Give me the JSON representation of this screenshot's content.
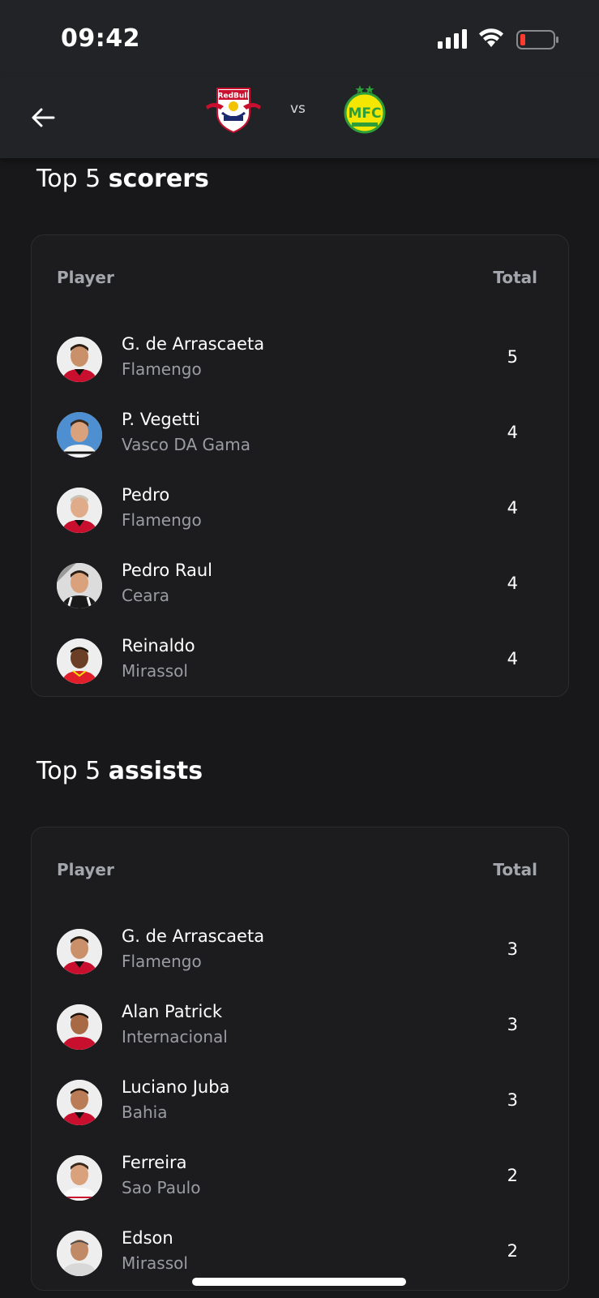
{
  "status_bar": {
    "time": "09:42"
  },
  "header": {
    "vs_label": "vs",
    "home_team_logo": "RedBull Bragantino",
    "away_team_logo": "MFC Mirassol"
  },
  "scorers": {
    "title_prefix": "Top 5 ",
    "title_bold": "scorers",
    "col_player": "Player",
    "col_total": "Total",
    "rows": [
      {
        "name": "G. de Arrascaeta",
        "team": "Flamengo",
        "value": "5"
      },
      {
        "name": "P. Vegetti",
        "team": "Vasco DA Gama",
        "value": "4"
      },
      {
        "name": "Pedro",
        "team": "Flamengo",
        "value": "4"
      },
      {
        "name": "Pedro Raul",
        "team": "Ceara",
        "value": "4"
      },
      {
        "name": "Reinaldo",
        "team": "Mirassol",
        "value": "4"
      }
    ]
  },
  "assists": {
    "title_prefix": "Top 5 ",
    "title_bold": "assists",
    "col_player": "Player",
    "col_total": "Total",
    "rows": [
      {
        "name": "G. de Arrascaeta",
        "team": "Flamengo",
        "value": "3"
      },
      {
        "name": "Alan Patrick",
        "team": "Internacional",
        "value": "3"
      },
      {
        "name": "Luciano Juba",
        "team": "Bahia",
        "value": "3"
      },
      {
        "name": "Ferreira",
        "team": "Sao Paulo",
        "value": "2"
      },
      {
        "name": "Edson",
        "team": "Mirassol",
        "value": "2"
      }
    ]
  }
}
